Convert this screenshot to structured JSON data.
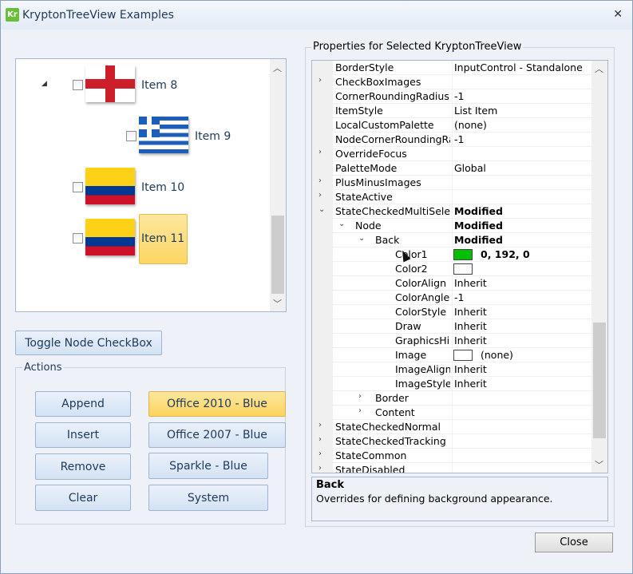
{
  "window": {
    "title": "KryptonTreeView Examples",
    "icon_text": "Kr"
  },
  "tree": {
    "items": [
      {
        "label": "Item 8",
        "flag": "england",
        "expanded": true
      },
      {
        "label": "Item 9",
        "flag": "greece"
      },
      {
        "label": "Item 10",
        "flag": "colombia"
      },
      {
        "label": "Item 11",
        "flag": "colombia",
        "selected": true
      }
    ]
  },
  "buttons": {
    "toggle": "Toggle Node CheckBox",
    "actions_title": "Actions",
    "append": "Append",
    "insert": "Insert",
    "remove": "Remove",
    "clear": "Clear",
    "office2010": "Office 2010 - Blue",
    "office2007": "Office 2007 - Blue",
    "sparkle": "Sparkle - Blue",
    "system": "System",
    "close": "Close"
  },
  "properties": {
    "title": "Properties for Selected KryptonTreeView",
    "rows": [
      {
        "name": "BorderStyle",
        "value": "InputControl - Standalone",
        "exp": ""
      },
      {
        "name": "CheckBoxImages",
        "value": "",
        "exp": "›"
      },
      {
        "name": "CornerRoundingRadius",
        "value": "-1",
        "exp": ""
      },
      {
        "name": "ItemStyle",
        "value": "List Item",
        "exp": ""
      },
      {
        "name": "LocalCustomPalette",
        "value": "(none)",
        "exp": ""
      },
      {
        "name": "NodeCornerRoundingRa",
        "value": "-1",
        "exp": ""
      },
      {
        "name": "OverrideFocus",
        "value": "",
        "exp": "›"
      },
      {
        "name": "PaletteMode",
        "value": "Global",
        "exp": ""
      },
      {
        "name": "PlusMinusImages",
        "value": "",
        "exp": "›"
      },
      {
        "name": "StateActive",
        "value": "",
        "exp": "›"
      },
      {
        "name": "StateCheckedMultiSelec",
        "value": "Modified",
        "exp": "⌄",
        "bold": true
      },
      {
        "name": "Node",
        "value": "Modified",
        "exp": "⌄",
        "bold": true
      },
      {
        "name": "Back",
        "value": "Modified",
        "exp": "⌄",
        "bold": true
      },
      {
        "name": "Color1",
        "value": "0, 192, 0",
        "exp": "",
        "bold": true
      },
      {
        "name": "Color2",
        "value": "",
        "exp": ""
      },
      {
        "name": "ColorAlign",
        "value": "Inherit",
        "exp": ""
      },
      {
        "name": "ColorAngle",
        "value": "-1",
        "exp": ""
      },
      {
        "name": "ColorStyle",
        "value": "Inherit",
        "exp": ""
      },
      {
        "name": "Draw",
        "value": "Inherit",
        "exp": ""
      },
      {
        "name": "GraphicsHi",
        "value": "Inherit",
        "exp": ""
      },
      {
        "name": "Image",
        "value": "(none)",
        "exp": ""
      },
      {
        "name": "ImageAlign",
        "value": "Inherit",
        "exp": ""
      },
      {
        "name": "ImageStyle",
        "value": "Inherit",
        "exp": ""
      },
      {
        "name": "Border",
        "value": "",
        "exp": "›"
      },
      {
        "name": "Content",
        "value": "",
        "exp": "›"
      },
      {
        "name": "StateCheckedNormal",
        "value": "",
        "exp": "›"
      },
      {
        "name": "StateCheckedTracking",
        "value": "",
        "exp": "›"
      },
      {
        "name": "StateCommon",
        "value": "",
        "exp": "›"
      },
      {
        "name": "StateDisabled",
        "value": "",
        "exp": "›"
      }
    ],
    "color1_swatch": "#00c000",
    "color2_swatch": "#ffffff",
    "image_swatch": "#ffffff"
  },
  "description": {
    "title": "Back",
    "text": "Overrides for defining background appearance."
  }
}
